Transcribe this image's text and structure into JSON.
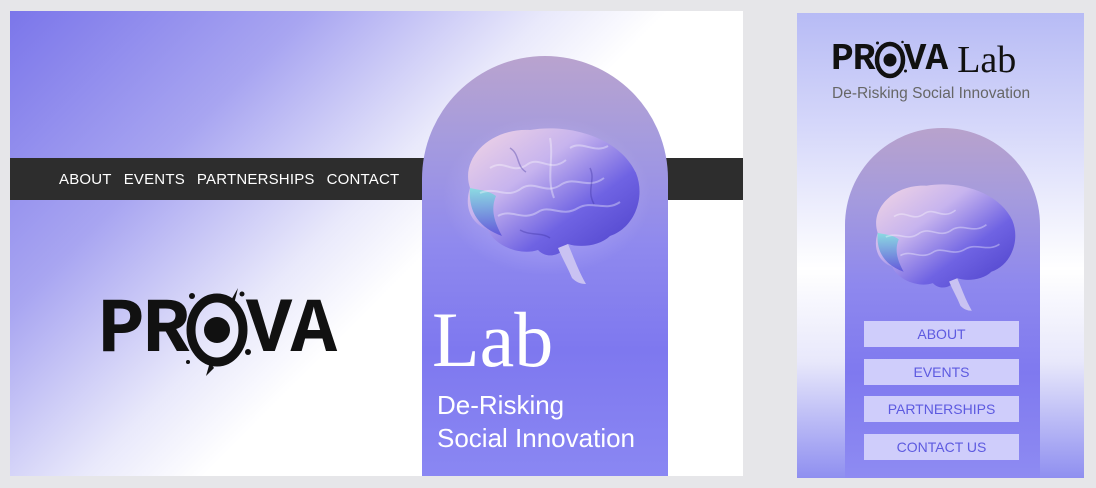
{
  "desktop": {
    "nav": {
      "items": [
        "ABOUT",
        "EVENTS",
        "PARTNERSHIPS",
        "CONTACT"
      ]
    },
    "logo": {
      "prefix": "PR",
      "o": "O",
      "suffix": "VA",
      "lab": "Lab"
    },
    "tagline": {
      "line1": "De-Risking",
      "line2": "Social Innovation"
    }
  },
  "mobile": {
    "logo": {
      "prefix": "PR",
      "o": "O",
      "suffix": "VA",
      "lab": "Lab"
    },
    "subtitle": "De-Risking Social Innovation",
    "buttons": [
      "ABOUT",
      "EVENTS",
      "PARTNERSHIPS",
      "CONTACT US"
    ]
  },
  "colors": {
    "navbar": "#2d2d2d",
    "accent": "#7b76ea",
    "button_bg": "#cfcdfb",
    "button_text": "#5d5ae0"
  },
  "icons": {
    "brain": "brain-illustration",
    "o_splatter": "ink-splatter-o"
  }
}
